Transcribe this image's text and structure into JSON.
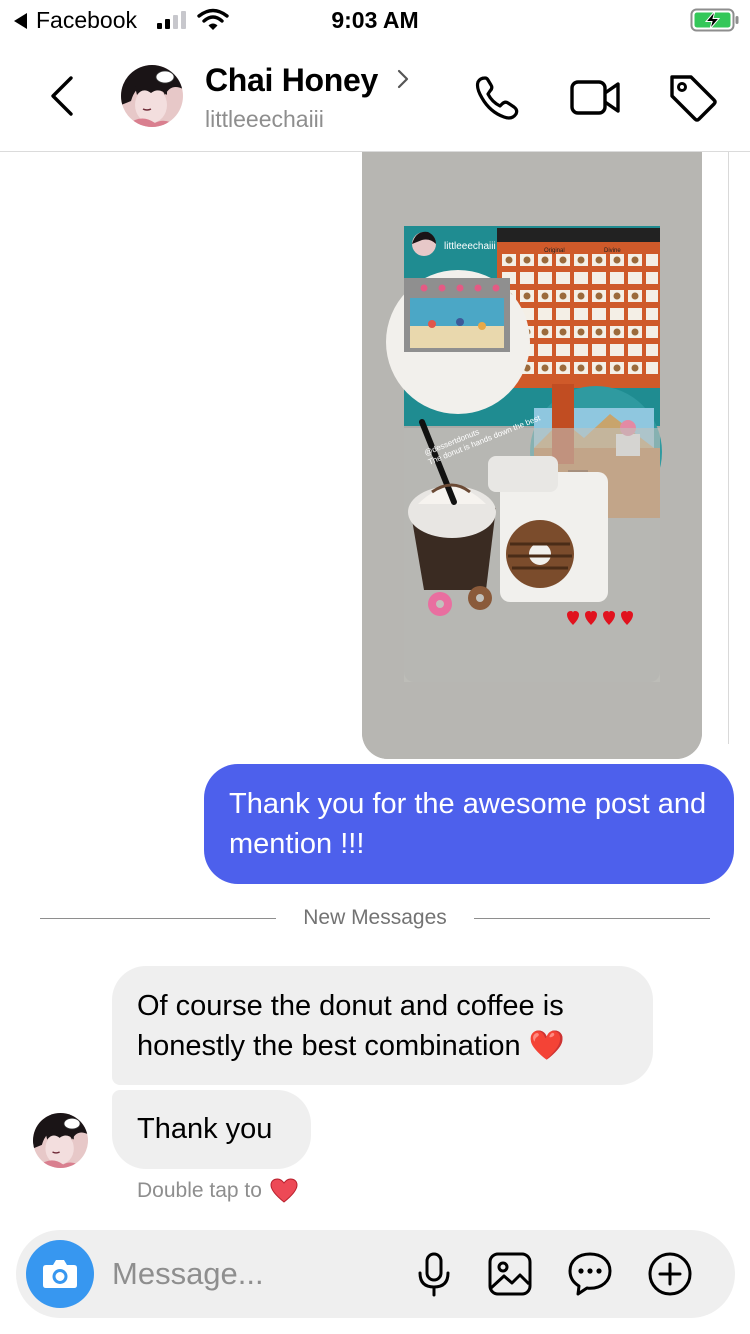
{
  "status_bar": {
    "back_app": "Facebook",
    "time": "9:03 AM"
  },
  "header": {
    "name": "Chai Honey",
    "username": "littleeechaiii"
  },
  "story": {
    "poster": "littleeechaiii",
    "tag": "@dessertdonuts",
    "caption": "The donut is hands down the best",
    "menu_heading_left": "Original",
    "menu_heading_right": "Divine"
  },
  "messages": {
    "sent": "Thank you for the awesome post and mention !!!",
    "divider": "New Messages",
    "received": [
      "Of course the donut and coffee is honestly the best combination ❤️",
      "Thank you"
    ],
    "tap_hint": "Double tap to"
  },
  "composer": {
    "placeholder": "Message..."
  },
  "colors": {
    "sent_bubble": "#4d60ec",
    "received_bubble": "#efefef",
    "camera_button": "#3797f0",
    "heart": "#ed4956",
    "divider": "#8e8e8e"
  },
  "icons": [
    "back-icon",
    "chevron-right-icon",
    "phone-icon",
    "video-icon",
    "tag-icon",
    "camera-icon",
    "microphone-icon",
    "gallery-icon",
    "sticker-icon",
    "plus-circle-icon",
    "heart-icon"
  ]
}
